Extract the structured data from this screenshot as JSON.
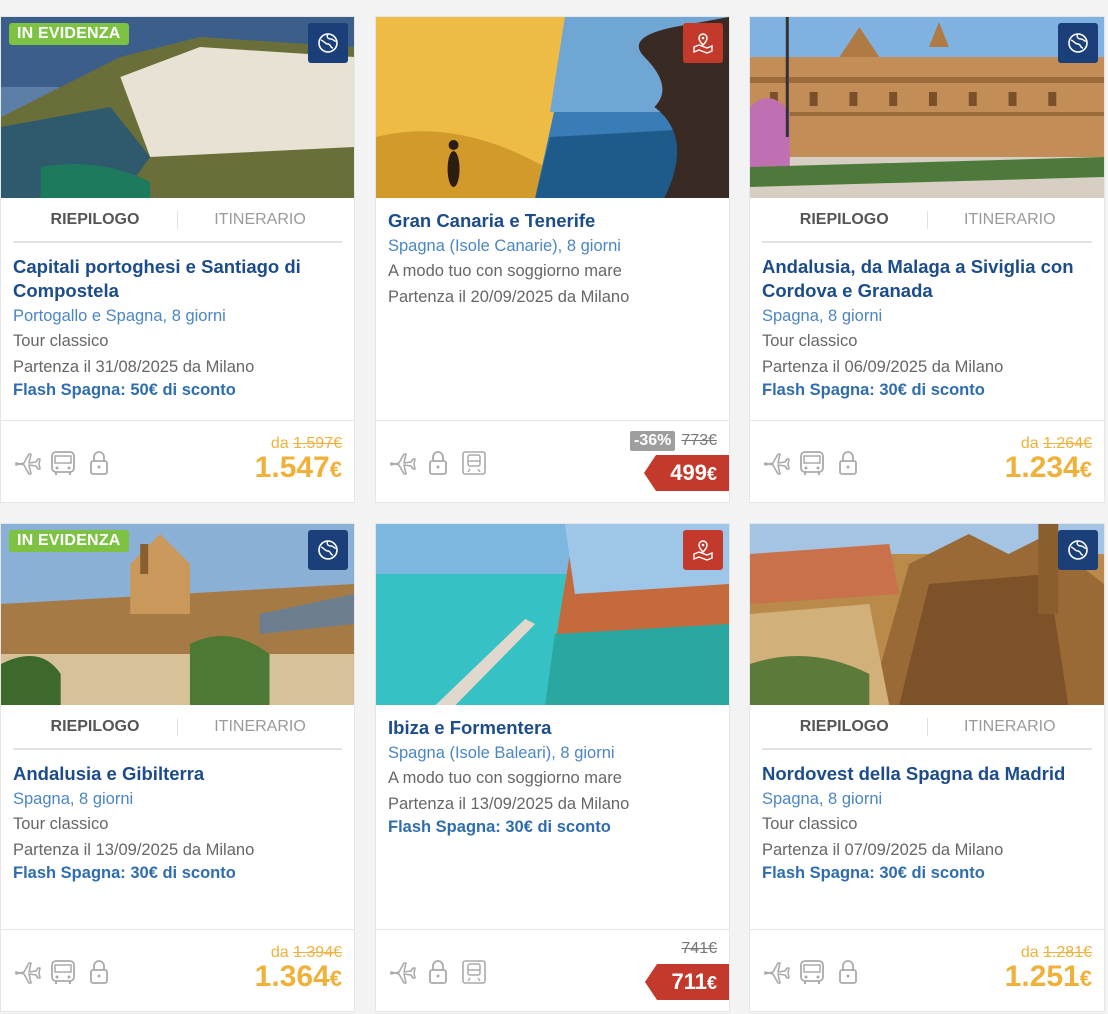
{
  "cards": [
    {
      "featured": "IN EVIDENZA",
      "corner_icon": "globe-icon",
      "tabs": [
        "RIEPILOGO",
        "ITINERARIO"
      ],
      "title": "Capitali portoghesi e Santiago di Compostela",
      "destination": "Portogallo e Spagna, 8 giorni",
      "type": "Tour classico",
      "departure": "Partenza il 31/08/2025 da Milano",
      "promo": "Flash Spagna: 50€ di sconto",
      "price_prefix": "da",
      "old_price": "1.597€",
      "price": "1.547",
      "currency": "€",
      "icons": [
        "plane-icon",
        "bus-icon",
        "lock-icon"
      ]
    },
    {
      "corner_icon": "map-pin-icon",
      "title": "Gran Canaria e Tenerife",
      "destination": "Spagna (Isole Canarie), 8 giorni",
      "type": "A modo tuo con soggiorno mare",
      "departure": "Partenza il 20/09/2025 da Milano",
      "discount": "-36%",
      "old_price": "773€",
      "price": "499",
      "currency": "€",
      "icons": [
        "plane-icon",
        "lock-icon",
        "train-icon"
      ]
    },
    {
      "corner_icon": "globe-icon",
      "tabs": [
        "RIEPILOGO",
        "ITINERARIO"
      ],
      "title": "Andalusia, da Malaga a Siviglia con Cordova e Granada",
      "destination": "Spagna, 8 giorni",
      "type": "Tour classico",
      "departure": "Partenza il 06/09/2025 da Milano",
      "promo": "Flash Spagna: 30€ di sconto",
      "price_prefix": "da",
      "old_price": "1.264€",
      "price": "1.234",
      "currency": "€",
      "icons": [
        "plane-icon",
        "bus-icon",
        "lock-icon"
      ]
    },
    {
      "featured": "IN EVIDENZA",
      "corner_icon": "globe-icon",
      "tabs": [
        "RIEPILOGO",
        "ITINERARIO"
      ],
      "title": "Andalusia e Gibilterra",
      "destination": "Spagna, 8 giorni",
      "type": "Tour classico",
      "departure": "Partenza il 13/09/2025 da Milano",
      "promo": "Flash Spagna: 30€ di sconto",
      "price_prefix": "da",
      "old_price": "1.394€",
      "price": "1.364",
      "currency": "€",
      "icons": [
        "plane-icon",
        "bus-icon",
        "lock-icon"
      ]
    },
    {
      "corner_icon": "map-pin-icon",
      "title": "Ibiza e Formentera",
      "destination": "Spagna (Isole Baleari), 8 giorni",
      "type": "A modo tuo con soggiorno mare",
      "departure": "Partenza il 13/09/2025 da Milano",
      "promo": "Flash Spagna: 30€ di sconto",
      "old_price": "741€",
      "price": "711",
      "currency": "€",
      "icons": [
        "plane-icon",
        "lock-icon",
        "train-icon"
      ]
    },
    {
      "corner_icon": "globe-icon",
      "tabs": [
        "RIEPILOGO",
        "ITINERARIO"
      ],
      "title": "Nordovest della Spagna da Madrid",
      "destination": "Spagna, 8 giorni",
      "type": "Tour classico",
      "departure": "Partenza il 07/09/2025 da Milano",
      "promo": "Flash Spagna: 30€ di sconto",
      "price_prefix": "da",
      "old_price": "1.281€",
      "price": "1.251",
      "currency": "€",
      "icons": [
        "plane-icon",
        "bus-icon",
        "lock-icon"
      ]
    }
  ],
  "colors": {
    "title": "#1c4c8c",
    "destination": "#4a86c5",
    "price_yellow": "#f0b13b",
    "price_red": "#c3392b",
    "featured_green": "#7dc242",
    "globe_badge": "#1b3f79"
  }
}
